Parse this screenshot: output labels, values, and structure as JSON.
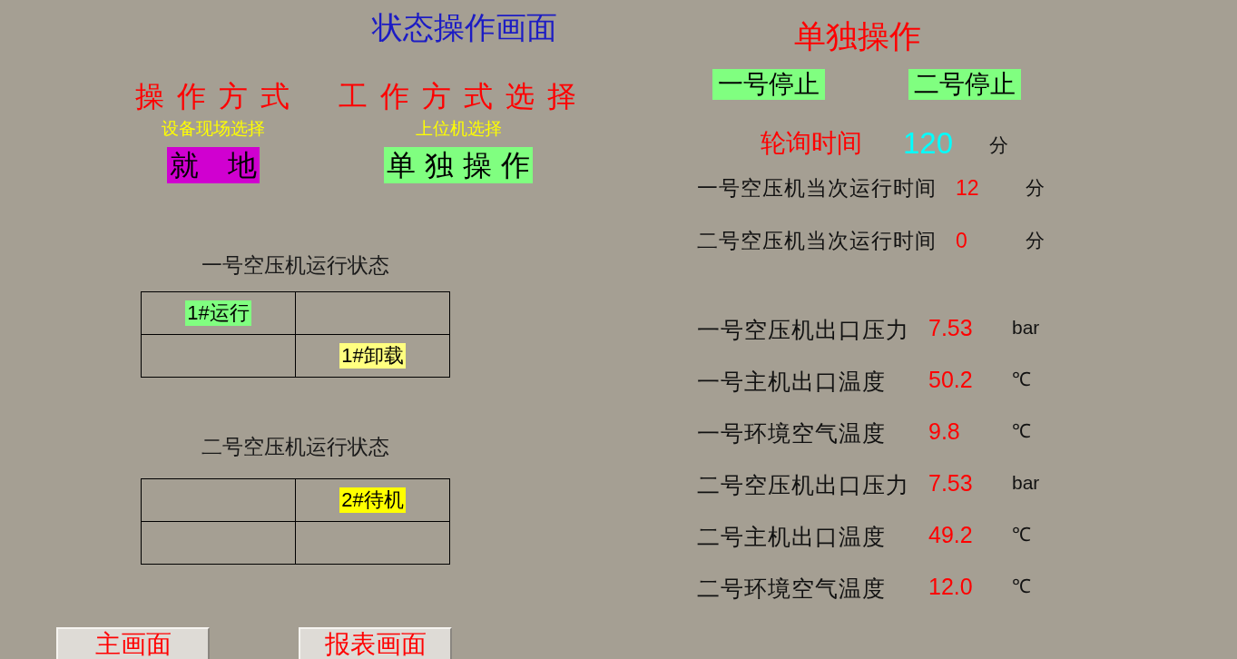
{
  "title": "状态操作画面",
  "mode_panels": [
    {
      "heading": "操 作 方 式",
      "subheading": "设备现场选择",
      "indicator": {
        "label": "就　地",
        "color": "#d000d0"
      }
    },
    {
      "heading": "工 作 方 式 选 择",
      "subheading": "上位机选择",
      "indicator": {
        "label": "单 独 操 作",
        "color": "#80ff80"
      }
    }
  ],
  "compressor_status": [
    {
      "title": "一号空压机运行状态",
      "rows": [
        {
          "cells": [
            {
              "status": "1#运行",
              "color": "#80ff80"
            },
            {}
          ]
        },
        {
          "cells": [
            {},
            {
              "status": "1#卸载",
              "color": "#ffff80"
            }
          ]
        }
      ]
    },
    {
      "title": "二号空压机运行状态",
      "rows": [
        {
          "cells": [
            {},
            {
              "status": "2#待机",
              "color": "#ffff00"
            }
          ]
        },
        {
          "cells": [
            {},
            {}
          ]
        }
      ]
    }
  ],
  "nav_buttons": [
    "主画面",
    "报表画面"
  ],
  "individual_control": {
    "title": "单独操作",
    "buttons": [
      "一号停止",
      "二号停止"
    ],
    "polling": {
      "label": "轮询时间",
      "value": "120",
      "unit": "分"
    },
    "run_times": [
      {
        "label": "一号空压机当次运行时间",
        "value": "12",
        "unit": "分"
      },
      {
        "label": "二号空压机当次运行时间",
        "value": "0",
        "unit": "分"
      }
    ]
  },
  "measurements": [
    {
      "label": "一号空压机出口压力",
      "value": "7.53",
      "unit": "bar"
    },
    {
      "label": "一号主机出口温度",
      "value": "50.2",
      "unit": "℃"
    },
    {
      "label": "一号环境空气温度",
      "value": "9.8",
      "unit": "℃"
    },
    {
      "label": "二号空压机出口压力",
      "value": "7.53",
      "unit": "bar"
    },
    {
      "label": "二号主机出口温度",
      "value": "49.2",
      "unit": "℃"
    },
    {
      "label": "二号环境空气温度",
      "value": "12.0",
      "unit": "℃"
    }
  ]
}
